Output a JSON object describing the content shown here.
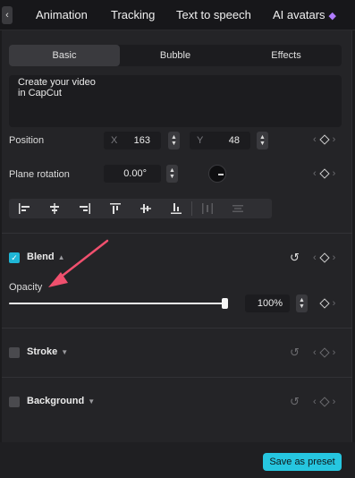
{
  "topnav": {
    "back_glyph": "‹",
    "tabs": [
      {
        "label": "Animation"
      },
      {
        "label": "Tracking"
      },
      {
        "label": "Text to speech"
      },
      {
        "label": "AI avatars",
        "icon": "premium-diamond-icon"
      }
    ]
  },
  "segments": [
    "Basic",
    "Bubble",
    "Effects"
  ],
  "active_segment": "Basic",
  "text_content": "Create your video\nin CapCut",
  "position": {
    "label": "Position",
    "x_axis": "X",
    "x_value": "163",
    "y_axis": "Y",
    "y_value": "48"
  },
  "rotation": {
    "label": "Plane rotation",
    "value": "0.00°"
  },
  "align_icons": [
    "align-left-icon",
    "align-center-horizontal-icon",
    "align-right-icon",
    "align-top-icon",
    "align-center-vertical-icon",
    "align-bottom-icon",
    "distribute-horizontal-icon",
    "distribute-vertical-icon"
  ],
  "blend": {
    "title": "Blend",
    "checked": true,
    "opacity_label": "Opacity",
    "opacity_value": "100%",
    "opacity_fraction": 1.0
  },
  "stroke": {
    "title": "Stroke",
    "checked": false
  },
  "background": {
    "title": "Background",
    "checked": false
  },
  "footer": {
    "save_preset_label": "Save as preset"
  },
  "colors": {
    "accent": "#26c6e0",
    "annotation_arrow": "#f0506e",
    "panel_bg": "#242427"
  }
}
